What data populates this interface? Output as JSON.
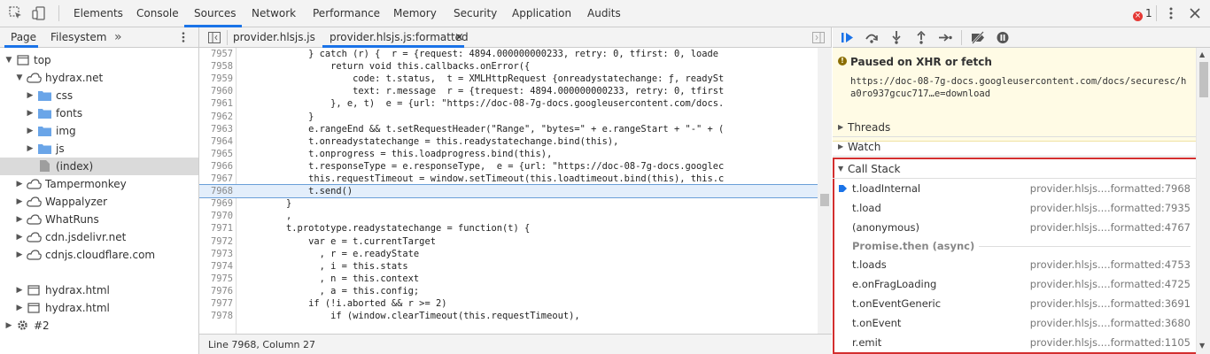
{
  "main_tabs": [
    "Elements",
    "Console",
    "Sources",
    "Network",
    "Performance",
    "Memory",
    "Security",
    "Application",
    "Audits"
  ],
  "error_count": "1",
  "navigator": {
    "tabs": [
      "Page",
      "Filesystem"
    ],
    "more": "»",
    "tree": [
      {
        "label": "top"
      },
      {
        "label": "hydrax.net"
      },
      {
        "label": "css"
      },
      {
        "label": "fonts"
      },
      {
        "label": "img"
      },
      {
        "label": "js"
      },
      {
        "label": "(index)"
      },
      {
        "label": "Tampermonkey"
      },
      {
        "label": "Wappalyzer"
      },
      {
        "label": "WhatRuns"
      },
      {
        "label": "cdn.jsdelivr.net"
      },
      {
        "label": "cdnjs.cloudflare.com"
      },
      {
        "label": "hydrax.html"
      },
      {
        "label": "hydrax.html"
      },
      {
        "label": "#2"
      }
    ]
  },
  "editor": {
    "tabs": [
      "provider.hlsjs.js",
      "provider.hlsjs.js:formatted"
    ],
    "close_glyph": "×",
    "lines": [
      {
        "n": "7957",
        "t": "            } catch (r) {  r = {request: 4894.000000000233, retry: 0, tfirst: 0, loade"
      },
      {
        "n": "7958",
        "t": "                return void this.callbacks.onError({"
      },
      {
        "n": "7959",
        "t": "                    code: t.status,  t = XMLHttpRequest {onreadystatechange: ƒ, readySt"
      },
      {
        "n": "7960",
        "t": "                    text: r.message  r = {trequest: 4894.000000000233, retry: 0, tfirst"
      },
      {
        "n": "7961",
        "t": "                }, e, t)  e = {url: \"https://doc-08-7g-docs.googleusercontent.com/docs."
      },
      {
        "n": "7962",
        "t": "            }"
      },
      {
        "n": "7963",
        "t": "            e.rangeEnd && t.setRequestHeader(\"Range\", \"bytes=\" + e.rangeStart + \"-\" + ("
      },
      {
        "n": "7964",
        "t": "            t.onreadystatechange = this.readystatechange.bind(this),"
      },
      {
        "n": "7965",
        "t": "            t.onprogress = this.loadprogress.bind(this),"
      },
      {
        "n": "7966",
        "t": "            t.responseType = e.responseType,  e = {url: \"https://doc-08-7g-docs.googlec"
      },
      {
        "n": "7967",
        "t": "            this.requestTimeout = window.setTimeout(this.loadtimeout.bind(this), this.c"
      },
      {
        "n": "7968",
        "t": "            t.send()"
      },
      {
        "n": "7969",
        "t": "        }"
      },
      {
        "n": "7970",
        "t": "        ,"
      },
      {
        "n": "7971",
        "t": "        t.prototype.readystatechange = function(t) {"
      },
      {
        "n": "7972",
        "t": "            var e = t.currentTarget"
      },
      {
        "n": "7973",
        "t": "              , r = e.readyState"
      },
      {
        "n": "7974",
        "t": "              , i = this.stats"
      },
      {
        "n": "7975",
        "t": "              , n = this.context"
      },
      {
        "n": "7976",
        "t": "              , a = this.config;"
      },
      {
        "n": "7977",
        "t": "            if (!i.aborted && r >= 2)"
      },
      {
        "n": "7978",
        "t": "                if (window.clearTimeout(this.requestTimeout),"
      }
    ],
    "status": "Line 7968, Column 27"
  },
  "debugger": {
    "paused_title": "Paused on XHR or fetch",
    "paused_url": "https://doc-08-7g-docs.googleusercontent.com/docs/securesc/ha0ro937gcuc717…e=download",
    "sections": [
      "Threads",
      "Watch",
      "Call Stack"
    ],
    "frames": [
      {
        "fn": "t.loadInternal",
        "loc": "provider.hlsjs....formatted:7968",
        "current": true
      },
      {
        "fn": "t.load",
        "loc": "provider.hlsjs....formatted:7935"
      },
      {
        "fn": "(anonymous)",
        "loc": "provider.hlsjs....formatted:4767"
      }
    ],
    "async_label": "Promise.then (async)",
    "frames_after": [
      {
        "fn": "t.loads",
        "loc": "provider.hlsjs....formatted:4753"
      },
      {
        "fn": "e.onFragLoading",
        "loc": "provider.hlsjs....formatted:4725"
      },
      {
        "fn": "t.onEventGeneric",
        "loc": "provider.hlsjs....formatted:3691"
      },
      {
        "fn": "t.onEvent",
        "loc": "provider.hlsjs....formatted:3680"
      },
      {
        "fn": "r.emit",
        "loc": "provider.hlsjs....formatted:1105"
      }
    ]
  }
}
